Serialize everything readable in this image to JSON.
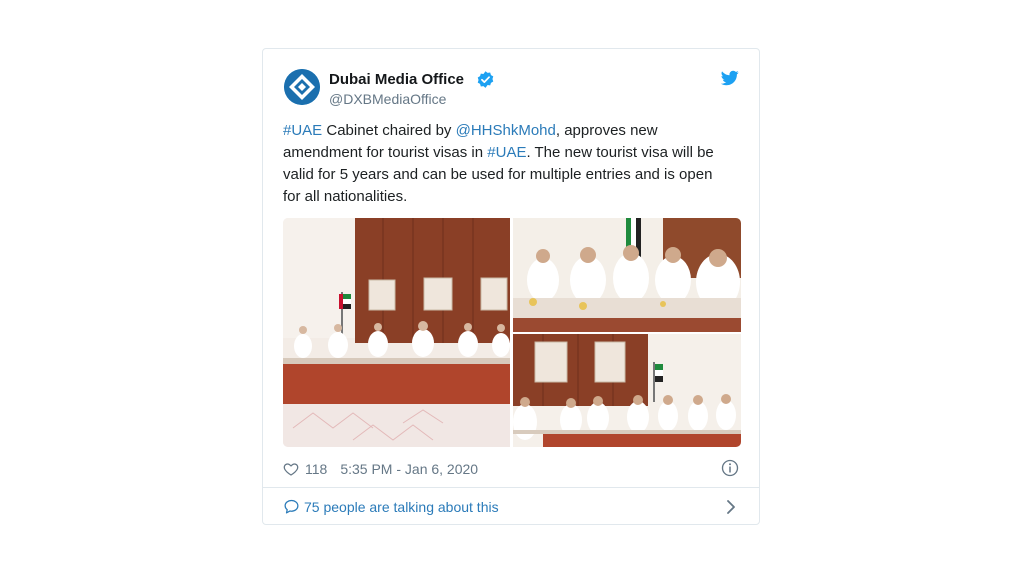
{
  "author": {
    "name": "Dubai Media Office",
    "handle": "@DXBMediaOffice"
  },
  "tweet": {
    "hashtag_uae": "#UAE",
    "text_1": " Cabinet chaired by ",
    "mention": "@HHShkMohd",
    "text_2": ", approves new amendment for tourist visas in ",
    "hashtag_uae_2": "#UAE",
    "text_3": ". The new tourist visa will be valid for 5 years and can be used for multiple entries and is open for all nationalities."
  },
  "stats": {
    "likes": "118",
    "timestamp": "5:35 PM - Jan 6, 2020"
  },
  "conversation": {
    "label": "75 people are talking about this"
  },
  "icons": {
    "verified": "verified-badge-icon",
    "brand": "twitter-bird-icon",
    "like": "heart-icon",
    "info": "info-icon",
    "reply": "comment-icon",
    "expand": "chevron-right-icon"
  },
  "colors": {
    "link": "#2b7bb9",
    "twitter_blue": "#1da1f2",
    "muted_text": "#657786",
    "border": "#e1e8ed"
  }
}
